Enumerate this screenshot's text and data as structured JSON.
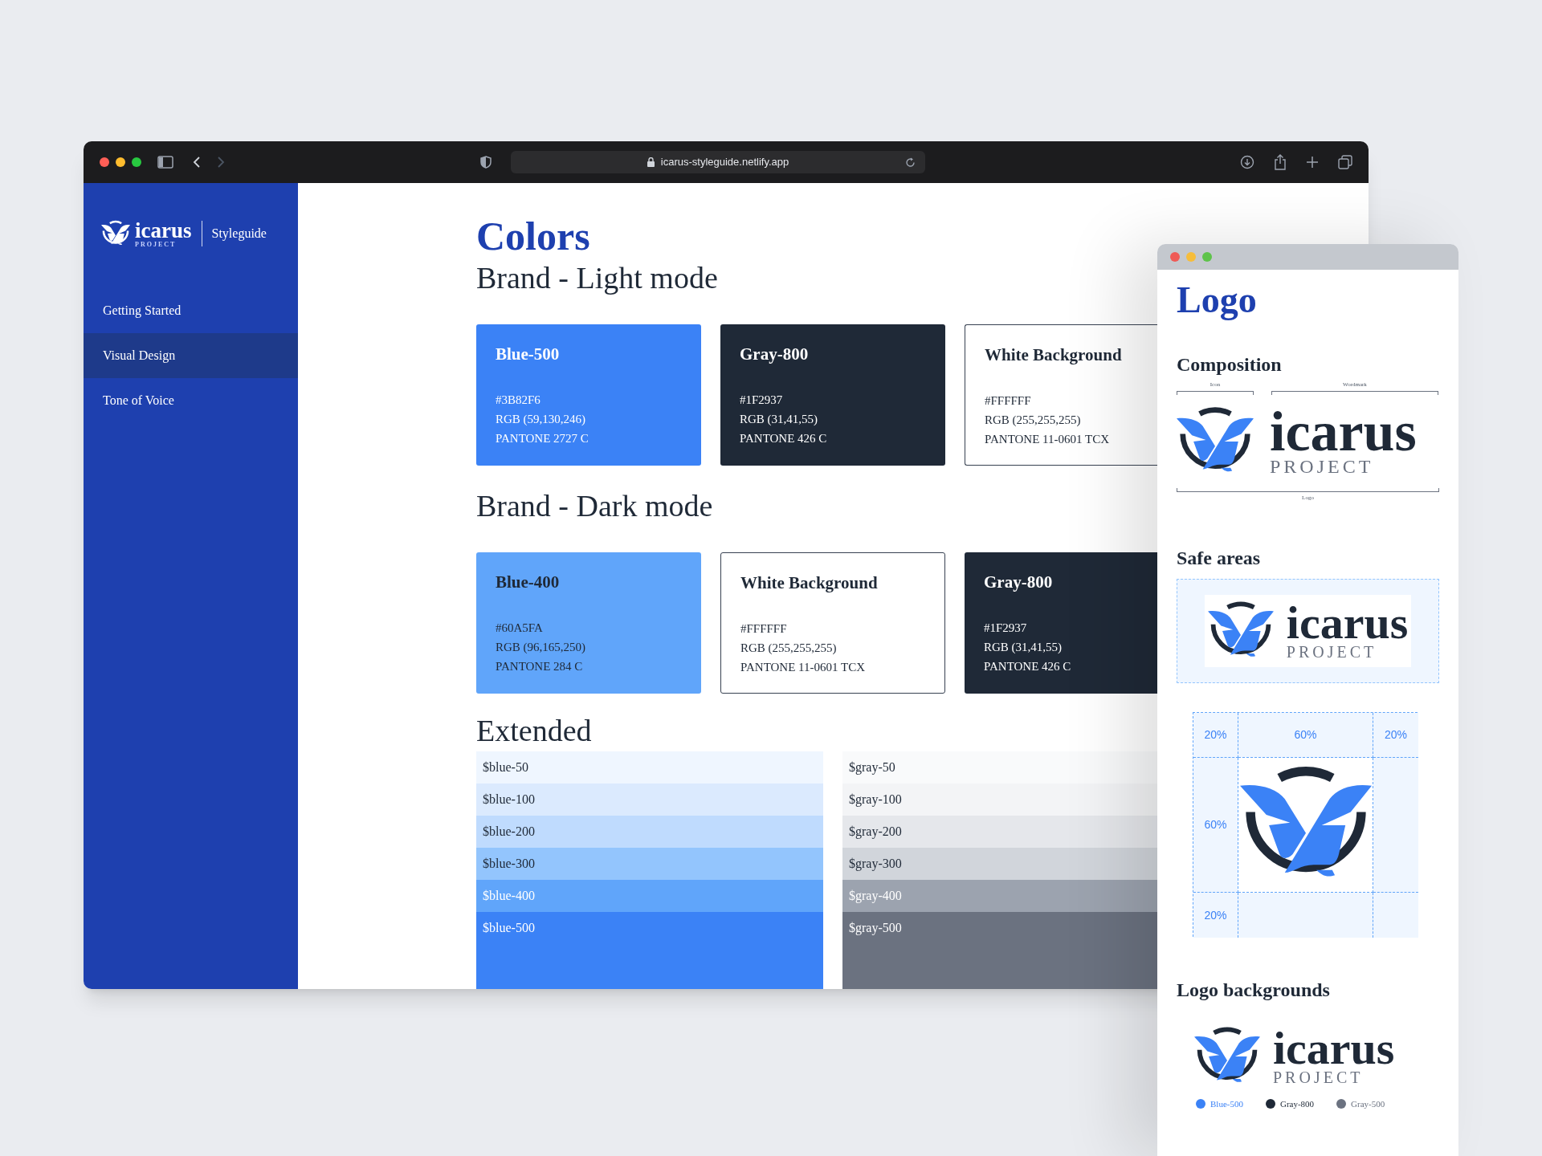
{
  "main_window": {
    "address": "icarus-styleguide.netlify.app",
    "sidebar": {
      "brand": {
        "wordmark": "icarus",
        "subtitle": "PROJECT",
        "product": "Styleguide"
      },
      "items": [
        {
          "label": "Getting Started",
          "selected": false
        },
        {
          "label": "Visual Design",
          "selected": true
        },
        {
          "label": "Tone of Voice",
          "selected": false
        }
      ]
    },
    "content": {
      "title": "Colors",
      "sections": [
        {
          "heading": "Brand - Light mode",
          "swatches": [
            {
              "name": "Blue-500",
              "hex": "#3B82F6",
              "rgb": "RGB (59,130,246)",
              "pantone": "PANTONE 2727 C",
              "color": "#3b82f6"
            },
            {
              "name": "Gray-800",
              "hex": "#1F2937",
              "rgb": "RGB (31,41,55)",
              "pantone": "PANTONE 426 C",
              "color": "#1f2937"
            },
            {
              "name": "White Background",
              "hex": "#FFFFFF",
              "rgb": "RGB (255,255,255)",
              "pantone": "PANTONE 11-0601 TCX",
              "color": "#ffffff"
            }
          ]
        },
        {
          "heading": "Brand - Dark mode",
          "swatches": [
            {
              "name": "Blue-400",
              "hex": "#60A5FA",
              "rgb": "RGB (96,165,250)",
              "pantone": "PANTONE 284 C",
              "color": "#60a5fa"
            },
            {
              "name": "White Background",
              "hex": "#FFFFFF",
              "rgb": "RGB (255,255,255)",
              "pantone": "PANTONE 11-0601 TCX",
              "color": "#ffffff"
            },
            {
              "name": "Gray-800",
              "hex": "#1F2937",
              "rgb": "RGB (31,41,55)",
              "pantone": "PANTONE 426 C",
              "color": "#1f2937"
            }
          ]
        }
      ],
      "extended": {
        "heading": "Extended",
        "columns": [
          {
            "rows": [
              {
                "label": "$blue-50",
                "color": "#eff6ff"
              },
              {
                "label": "$blue-100",
                "color": "#dbeafe"
              },
              {
                "label": "$blue-200",
                "color": "#bfdbfe"
              },
              {
                "label": "$blue-300",
                "color": "#93c5fd"
              },
              {
                "label": "$blue-400",
                "color": "#60a5fa"
              },
              {
                "label": "$blue-500",
                "color": "#3b82f6"
              }
            ]
          },
          {
            "rows": [
              {
                "label": "$gray-50",
                "color": "#f9fafb"
              },
              {
                "label": "$gray-100",
                "color": "#f3f4f6"
              },
              {
                "label": "$gray-200",
                "color": "#e5e7eb"
              },
              {
                "label": "$gray-300",
                "color": "#d1d5db"
              },
              {
                "label": "$gray-400",
                "color": "#9ca3af"
              },
              {
                "label": "$gray-500",
                "color": "#6b7280"
              }
            ]
          }
        ]
      }
    }
  },
  "logo_window": {
    "title": "Logo",
    "composition": {
      "heading": "Composition",
      "icon_label": "Icon",
      "wordmark_label": "Wordmark",
      "logo_label": "Logo",
      "wordmark": "icarus",
      "subtitle": "PROJECT"
    },
    "safe_areas": {
      "heading": "Safe areas",
      "wordmark": "icarus",
      "subtitle": "PROJECT",
      "grid_labels": [
        "20%",
        "60%",
        "20%",
        "60%",
        "20%"
      ]
    },
    "logo_backgrounds": {
      "heading": "Logo backgrounds",
      "wordmark": "icarus",
      "subtitle": "PROJECT",
      "legend": [
        {
          "label": "Blue-500",
          "color": "#3b82f6"
        },
        {
          "label": "Gray-800",
          "color": "#1f2937"
        },
        {
          "label": "Gray-500",
          "color": "#6b7280"
        }
      ]
    }
  }
}
